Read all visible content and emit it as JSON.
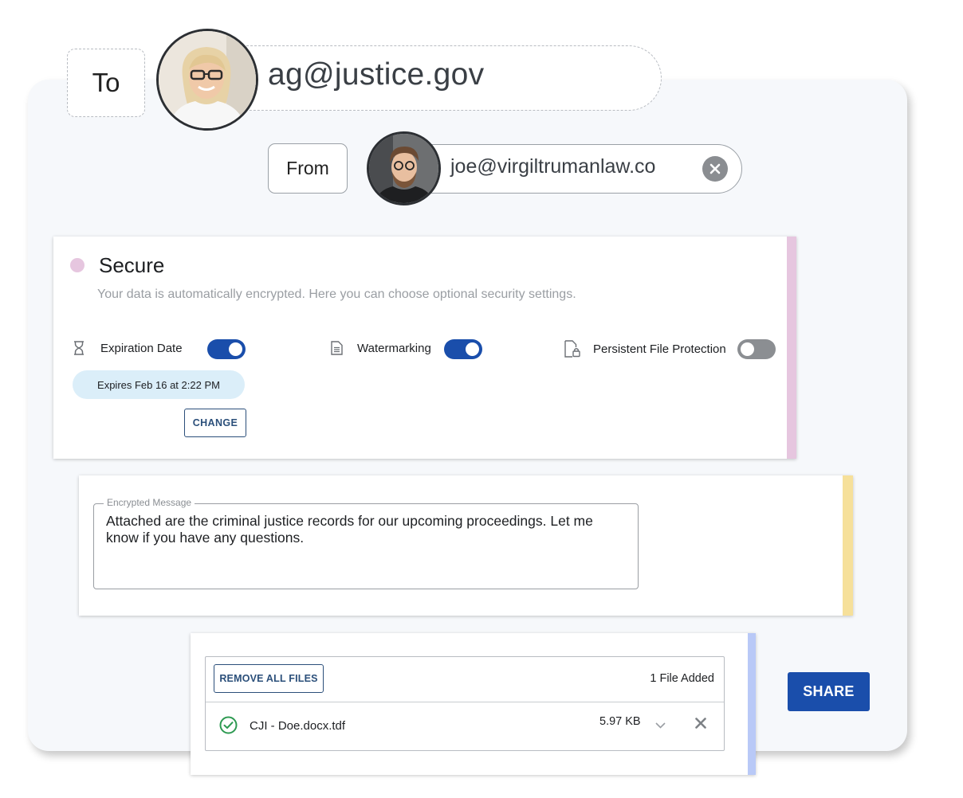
{
  "to": {
    "label": "To",
    "email": "ag@justice.gov",
    "avatar": "recipient-avatar"
  },
  "from": {
    "label": "From",
    "email": "joe@virgiltrumanlaw.co",
    "avatar": "sender-avatar",
    "clear_icon": "close-circle-icon"
  },
  "security": {
    "title": "Secure",
    "description": "Your data is automatically encrypted. Here you can choose optional security settings.",
    "options": [
      {
        "label": "Expiration Date",
        "icon": "hourglass-icon",
        "enabled": true
      },
      {
        "label": "Watermarking",
        "icon": "document-icon",
        "enabled": true
      },
      {
        "label": "Persistent File Protection",
        "icon": "file-lock-icon",
        "enabled": false
      }
    ],
    "expires_text": "Expires Feb 16 at 2:22 PM",
    "change_label": "CHANGE",
    "accent_color": "#e6c6df"
  },
  "message": {
    "legend": "Encrypted Message",
    "text": "Attached are the criminal justice records for our upcoming proceedings. Let me know if you have any questions.",
    "accent_color": "#f6e09a"
  },
  "files": {
    "remove_all_label": "REMOVE ALL FILES",
    "count_text": "1 File Added",
    "items": [
      {
        "name": "CJI - Doe.docx.tdf",
        "size": "5.97 KB",
        "status": "uploaded"
      }
    ],
    "accent_color": "#b9c9f7"
  },
  "share_label": "SHARE",
  "colors": {
    "primary": "#1a4eab",
    "outline_button": "#2b4f7a",
    "success": "#2e9a52"
  }
}
